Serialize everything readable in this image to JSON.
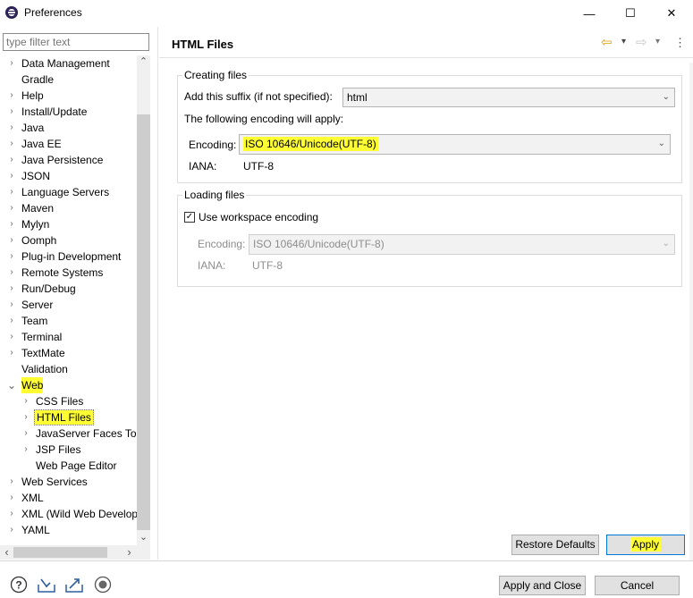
{
  "window": {
    "title": "Preferences",
    "minimize": "—",
    "maximize": "☐",
    "close": "✕"
  },
  "filter": {
    "placeholder": "type filter text"
  },
  "tree": [
    {
      "label": "Data Management",
      "chevron": "›"
    },
    {
      "label": "Gradle",
      "chevron": ""
    },
    {
      "label": "Help",
      "chevron": "›"
    },
    {
      "label": "Install/Update",
      "chevron": "›"
    },
    {
      "label": "Java",
      "chevron": "›"
    },
    {
      "label": "Java EE",
      "chevron": "›"
    },
    {
      "label": "Java Persistence",
      "chevron": "›"
    },
    {
      "label": "JSON",
      "chevron": "›"
    },
    {
      "label": "Language Servers",
      "chevron": "›"
    },
    {
      "label": "Maven",
      "chevron": "›"
    },
    {
      "label": "Mylyn",
      "chevron": "›"
    },
    {
      "label": "Oomph",
      "chevron": "›"
    },
    {
      "label": "Plug-in Development",
      "chevron": "›"
    },
    {
      "label": "Remote Systems",
      "chevron": "›"
    },
    {
      "label": "Run/Debug",
      "chevron": "›"
    },
    {
      "label": "Server",
      "chevron": "›"
    },
    {
      "label": "Team",
      "chevron": "›"
    },
    {
      "label": "Terminal",
      "chevron": "›"
    },
    {
      "label": "TextMate",
      "chevron": "›"
    },
    {
      "label": "Validation",
      "chevron": ""
    },
    {
      "label": "Web",
      "chevron": "⌄"
    },
    {
      "label": "CSS Files",
      "chevron": "›"
    },
    {
      "label": "HTML Files",
      "chevron": "›"
    },
    {
      "label": "JavaServer Faces Tools",
      "chevron": "›"
    },
    {
      "label": "JSP Files",
      "chevron": "›"
    },
    {
      "label": "Web Page Editor",
      "chevron": ""
    },
    {
      "label": "Web Services",
      "chevron": "›"
    },
    {
      "label": "XML",
      "chevron": "›"
    },
    {
      "label": "XML (Wild Web Developer)",
      "chevron": "›"
    },
    {
      "label": "YAML",
      "chevron": "›"
    }
  ],
  "scroll": {
    "up": "⌃",
    "down": "⌄",
    "left": "‹",
    "right": "›"
  },
  "page": {
    "title": "HTML Files",
    "nav_back": "⇦",
    "nav_forward": "⇨",
    "dropdown": "▾",
    "menu": "⋮"
  },
  "creating": {
    "group_label": "Creating files",
    "suffix_label": "Add this suffix (if not specified):",
    "suffix_value": "html",
    "encoding_note": "The following encoding will apply:",
    "encoding_label": "Encoding:",
    "encoding_value": "ISO 10646/Unicode(UTF-8)",
    "iana_label": "IANA:",
    "iana_value": "UTF-8"
  },
  "loading": {
    "group_label": "Loading files",
    "checkbox_label": "Use workspace encoding",
    "checkbox_checked": "✓",
    "encoding_label": "Encoding:",
    "encoding_value": "ISO 10646/Unicode(UTF-8)",
    "iana_label": "IANA:",
    "iana_value": "UTF-8"
  },
  "buttons": {
    "restore_defaults": "Restore Defaults",
    "apply": "Apply",
    "apply_and_close": "Apply and Close",
    "cancel": "Cancel"
  },
  "colors": {
    "highlight": "#ffff33",
    "focus": "#0078d7"
  }
}
